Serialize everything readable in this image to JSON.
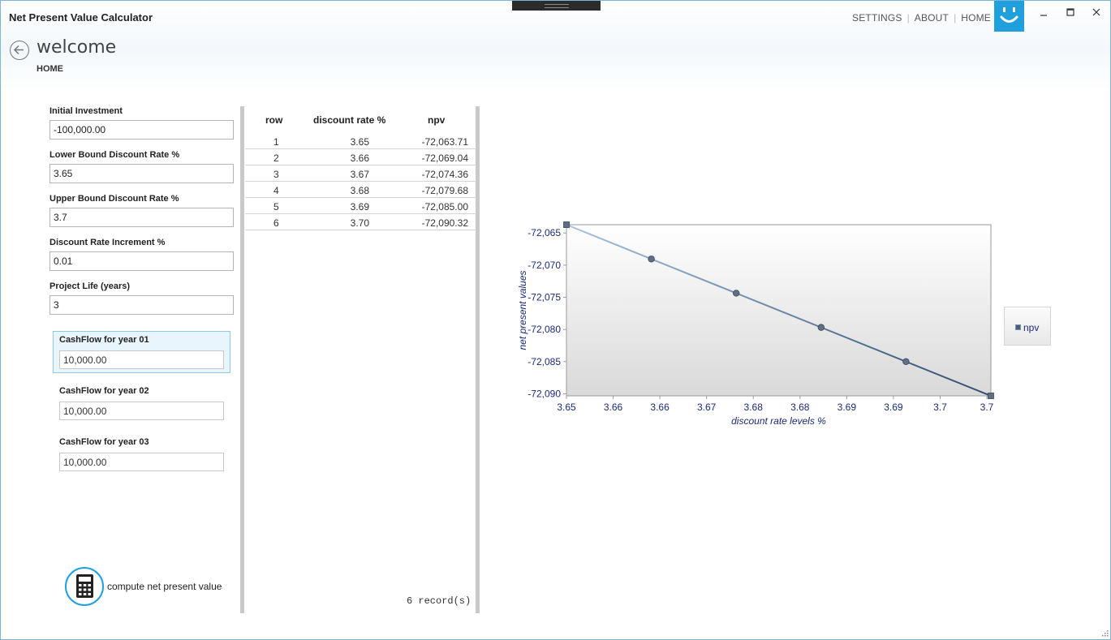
{
  "app": {
    "title": "Net Present Value Calculator",
    "nav": [
      "SETTINGS",
      "ABOUT",
      "HOME"
    ],
    "window_controls": [
      "minimize-icon",
      "maximize-icon",
      "close-icon"
    ]
  },
  "page": {
    "title": "welcome",
    "breadcrumb": "HOME"
  },
  "form": {
    "initial_investment": {
      "label": "Initial Investment",
      "value": "-100,000.00"
    },
    "lower_bound": {
      "label": "Lower Bound Discount Rate %",
      "value": "3.65"
    },
    "upper_bound": {
      "label": "Upper Bound Discount Rate %",
      "value": "3.7"
    },
    "increment": {
      "label": "Discount Rate Increment %",
      "value": "0.01"
    },
    "project_life": {
      "label": "Project Life (years)",
      "value": "3"
    },
    "cashflows": [
      {
        "label": "CashFlow for year 01",
        "value": "10,000.00"
      },
      {
        "label": "CashFlow for year 02",
        "value": "10,000.00"
      },
      {
        "label": "CashFlow for year 03",
        "value": "10,000.00"
      }
    ],
    "compute_label": "compute net present value"
  },
  "grid": {
    "headers": [
      "row",
      "discount rate %",
      "npv"
    ],
    "rows": [
      {
        "row": "1",
        "rate": "3.65",
        "npv": "-72,063.71"
      },
      {
        "row": "2",
        "rate": "3.66",
        "npv": "-72,069.04"
      },
      {
        "row": "3",
        "rate": "3.67",
        "npv": "-72,074.36"
      },
      {
        "row": "4",
        "rate": "3.68",
        "npv": "-72,079.68"
      },
      {
        "row": "5",
        "rate": "3.69",
        "npv": "-72,085.00"
      },
      {
        "row": "6",
        "rate": "3.70",
        "npv": "-72,090.32"
      }
    ],
    "records": "6 record(s)"
  },
  "chart_data": {
    "type": "line",
    "x": [
      3.65,
      3.66,
      3.67,
      3.68,
      3.69,
      3.7
    ],
    "series": [
      {
        "name": "npv",
        "values": [
          -72063.71,
          -72069.04,
          -72074.36,
          -72079.68,
          -72085.0,
          -72090.32
        ]
      }
    ],
    "xlabel": "discount rate levels %",
    "ylabel": "net present values",
    "x_ticks": [
      "3.65",
      "3.66",
      "3.66",
      "3.67",
      "3.68",
      "3.68",
      "3.69",
      "3.69",
      "3.7",
      "3.7"
    ],
    "y_ticks": [
      "-72,065",
      "-72,070",
      "-72,075",
      "-72,080",
      "-72,085",
      "-72,090"
    ],
    "xlim": [
      3.65,
      3.7
    ],
    "ylim": [
      -72090.32,
      -72063.71
    ],
    "legend": "right",
    "colors": {
      "line_start": "#a8c4dc",
      "line_end": "#2e4a6e",
      "axis_text": "#1a2a7a",
      "marker": "#5f6f84"
    }
  },
  "colors": {
    "accent": "#1fa0dc"
  }
}
